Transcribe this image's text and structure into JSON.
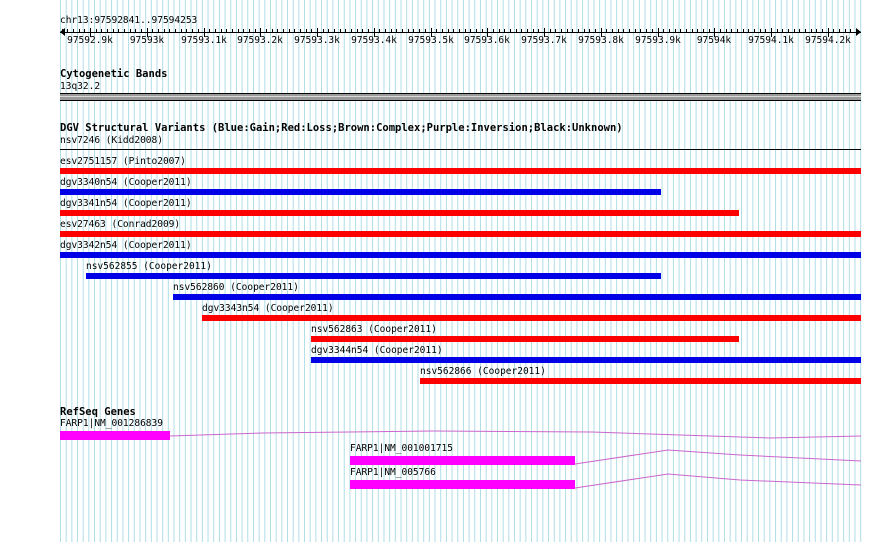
{
  "ruler": {
    "location": "chr13:97592841..97594253",
    "tick_labels": [
      "97592.9k",
      "97593k",
      "97593.1k",
      "97593.2k",
      "97593.3k",
      "97593.4k",
      "97593.5k",
      "97593.6k",
      "97593.7k",
      "97593.8k",
      "97593.9k",
      "97594k",
      "97594.1k",
      "97594.2k"
    ]
  },
  "cyto": {
    "title": "Cytogenetic Bands",
    "band": "13q32.2"
  },
  "dgv": {
    "title": "DGV Structural Variants (Blue:Gain;Red:Loss;Brown:Complex;Purple:Inversion;Black:Unknown)",
    "first_label": "nsv7246 (Kidd2008)",
    "variants": [
      {
        "label": "esv2751157 (Pinto2007)",
        "type": "loss"
      },
      {
        "label": "dgv3340n54 (Cooper2011)",
        "type": "gain"
      },
      {
        "label": "dgv3341n54 (Cooper2011)",
        "type": "loss"
      },
      {
        "label": "esv27463 (Conrad2009)",
        "type": "loss"
      },
      {
        "label": "dgv3342n54 (Cooper2011)",
        "type": "gain"
      },
      {
        "label": "nsv562855 (Cooper2011)",
        "type": "gain"
      },
      {
        "label": "nsv562860 (Cooper2011)",
        "type": "gain"
      },
      {
        "label": "dgv3343n54 (Cooper2011)",
        "type": "loss"
      },
      {
        "label": "nsv562863 (Cooper2011)",
        "type": "loss"
      },
      {
        "label": "dgv3344n54 (Cooper2011)",
        "type": "gain"
      },
      {
        "label": "nsv562866 (Cooper2011)",
        "type": "loss"
      }
    ]
  },
  "genes": {
    "title": "RefSeq Genes",
    "transcripts": [
      {
        "label": "FARP1|NM_001286839"
      },
      {
        "label": "FARP1|NM_001001715"
      },
      {
        "label": "FARP1|NM_005766"
      }
    ]
  },
  "colors": {
    "gain": "#0000e6",
    "loss": "#ff0000",
    "gene": "#ff00ff",
    "intron": "#cc66cc",
    "grid": "#b0dde6"
  }
}
